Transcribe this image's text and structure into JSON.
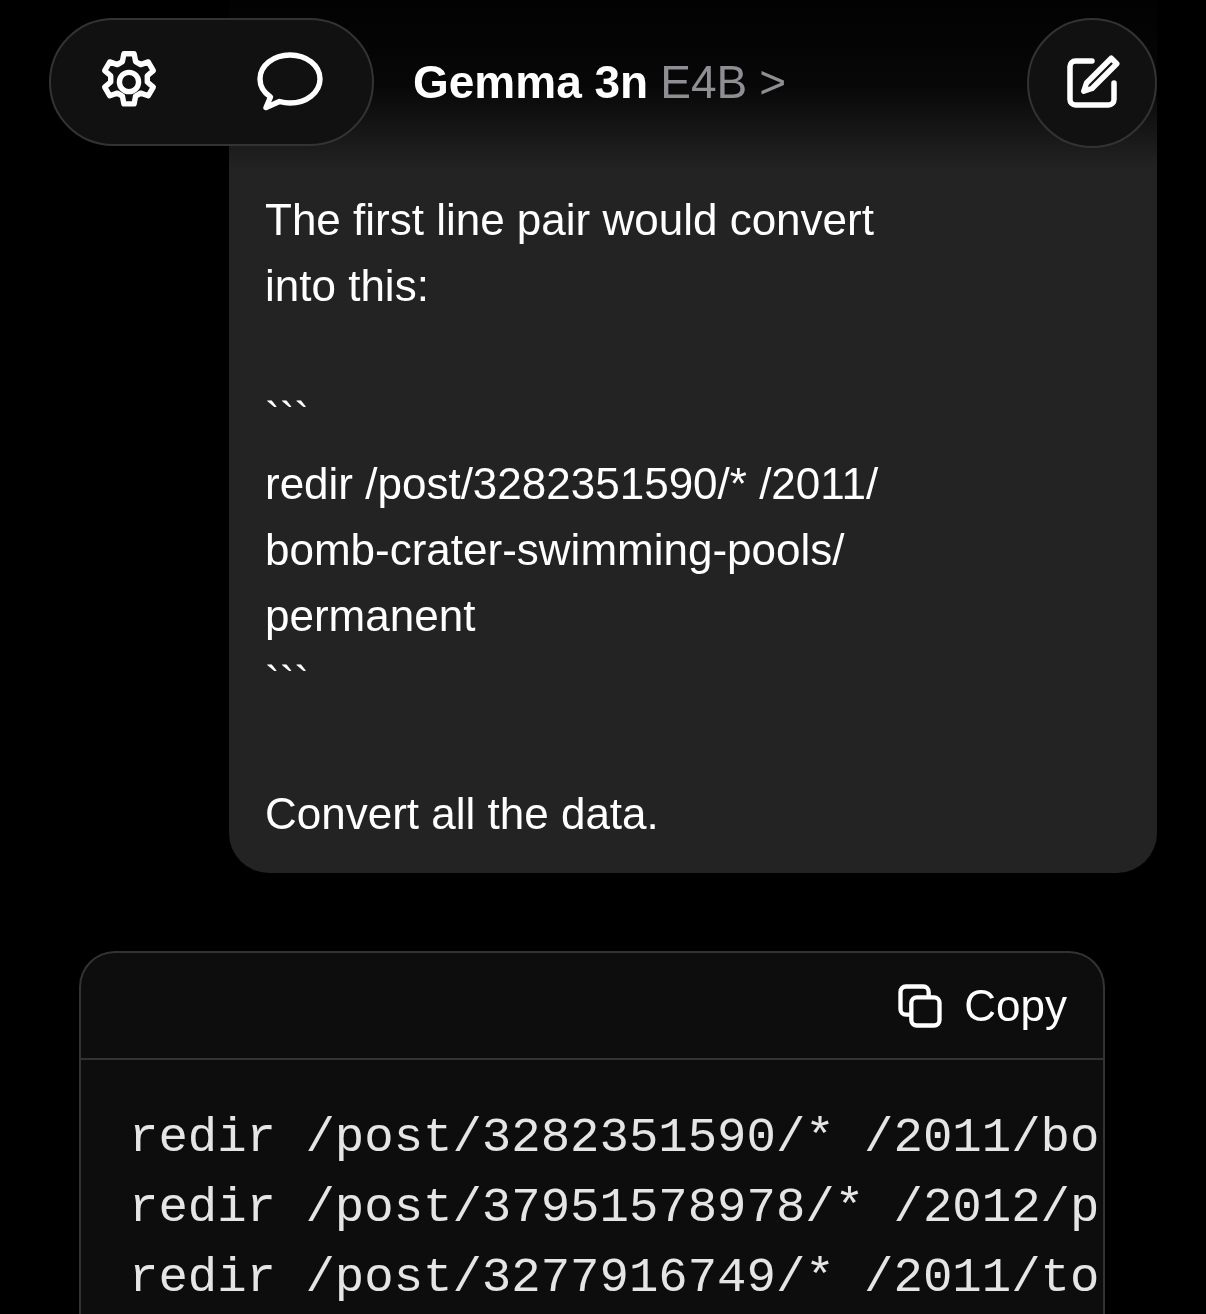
{
  "header": {
    "model_name": "Gemma 3n",
    "model_variant": "E4B",
    "chevron": ">"
  },
  "user_message": {
    "paragraphs": [
      {
        "lines": [
          "The first line pair would convert",
          "into this:"
        ]
      },
      {
        "lines": [
          "```",
          "redir /post/3282351590/* /2011/",
          "bomb-crater-swimming-pools/",
          "permanent",
          "```"
        ]
      },
      {
        "lines": [
          "Convert all the data."
        ]
      }
    ]
  },
  "code_block": {
    "copy_label": "Copy",
    "lines": [
      "redir /post/3282351590/* /2011/bo",
      "redir /post/37951578978/* /2012/p",
      "redir /post/3277916749/* /2011/to"
    ]
  }
}
